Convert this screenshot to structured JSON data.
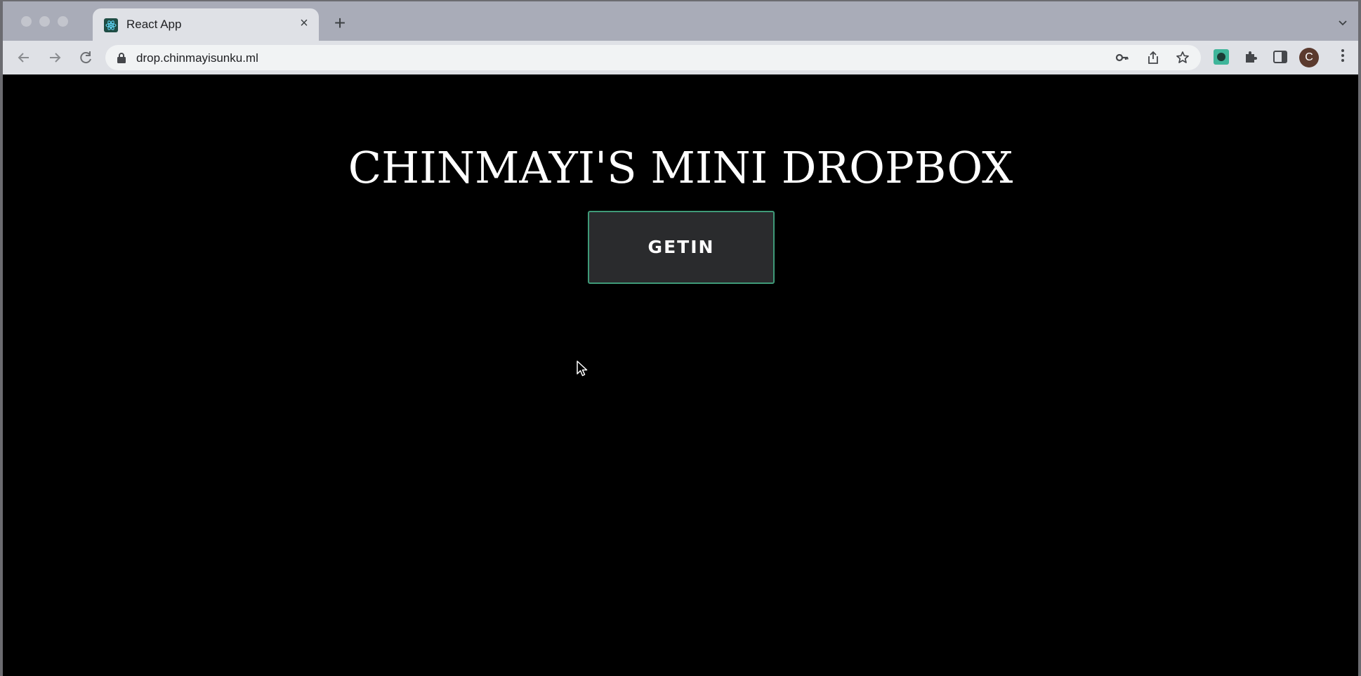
{
  "browser": {
    "tab": {
      "title": "React App",
      "close_glyph": "×",
      "favicon": "react-logo-icon"
    },
    "new_tab_glyph": "+",
    "address_bar": {
      "url": "drop.chinmayisunku.ml"
    },
    "profile_initial": "C",
    "colors": {
      "tabstrip": "#a9acb8",
      "toolbar": "#dfe1e6",
      "omnibox": "#f1f3f4"
    }
  },
  "page": {
    "title": "CHINMAYI'S MINI DROPBOX",
    "getin_button_label": "GETIN",
    "colors": {
      "background": "#000000",
      "button_background": "#2a2b2d",
      "button_border": "#3f9a78",
      "text": "#ffffff"
    }
  }
}
